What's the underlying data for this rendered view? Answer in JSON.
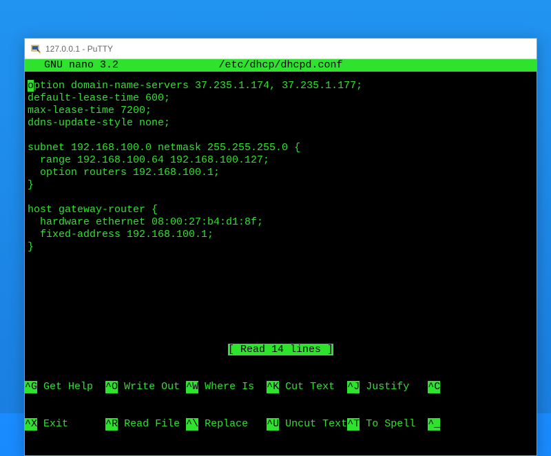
{
  "window": {
    "title": "127.0.0.1 - PuTTY"
  },
  "nano": {
    "brand": "  GNU nano 3.2",
    "file": "/etc/dhcp/dhcpd.conf",
    "status": "[ Read 14 lines ]",
    "content_first_char": "o",
    "content_rest": "ption domain-name-servers 37.235.1.174, 37.235.1.177;\ndefault-lease-time 600;\nmax-lease-time 7200;\nddns-update-style none;\n\nsubnet 192.168.100.0 netmask 255.255.255.0 {\n  range 192.168.100.64 192.168.100.127;\n  option routers 192.168.100.1;\n}\n\nhost gateway-router {\n  hardware ethernet 08:00:27:b4:d1:8f;\n  fixed-address 192.168.100.1;\n}",
    "shortcuts_row1": [
      {
        "key": "^G",
        "label": " Get Help  "
      },
      {
        "key": "^O",
        "label": " Write Out "
      },
      {
        "key": "^W",
        "label": " Where Is  "
      },
      {
        "key": "^K",
        "label": " Cut Text  "
      },
      {
        "key": "^J",
        "label": " Justify   "
      },
      {
        "key": "^C",
        "label": ""
      }
    ],
    "shortcuts_row2": [
      {
        "key": "^X",
        "label": " Exit      "
      },
      {
        "key": "^R",
        "label": " Read File "
      },
      {
        "key": "^\\",
        "label": " Replace   "
      },
      {
        "key": "^U",
        "label": " Uncut Text"
      },
      {
        "key": "^T",
        "label": " To Spell  "
      },
      {
        "key": "^_",
        "label": ""
      }
    ]
  }
}
